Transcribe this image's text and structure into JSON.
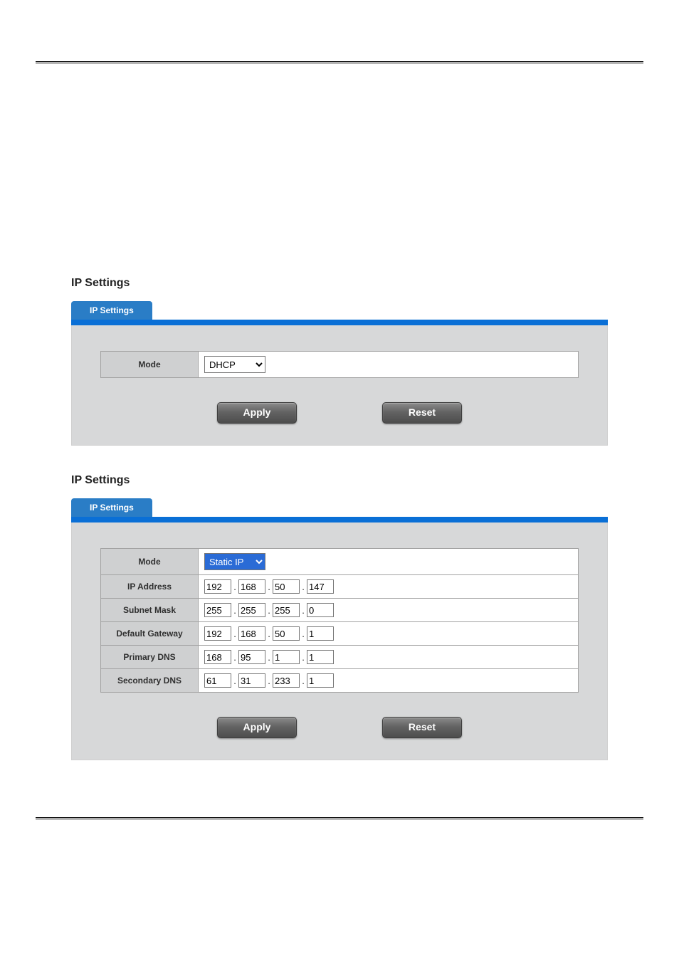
{
  "section1": {
    "title": "IP Settings",
    "tab_label": "IP Settings",
    "rows": {
      "mode": {
        "label": "Mode",
        "value": "DHCP",
        "options": [
          "DHCP",
          "Static IP"
        ]
      }
    },
    "buttons": {
      "apply": "Apply",
      "reset": "Reset"
    }
  },
  "section2": {
    "title": "IP Settings",
    "tab_label": "IP Settings",
    "rows": {
      "mode": {
        "label": "Mode",
        "value": "Static IP",
        "options": [
          "DHCP",
          "Static IP"
        ],
        "highlighted": true
      },
      "ip_address": {
        "label": "IP Address",
        "octets": [
          "192",
          "168",
          "50",
          "147"
        ]
      },
      "subnet_mask": {
        "label": "Subnet Mask",
        "octets": [
          "255",
          "255",
          "255",
          "0"
        ]
      },
      "default_gateway": {
        "label": "Default Gateway",
        "octets": [
          "192",
          "168",
          "50",
          "1"
        ]
      },
      "primary_dns": {
        "label": "Primary DNS",
        "octets": [
          "168",
          "95",
          "1",
          "1"
        ]
      },
      "secondary_dns": {
        "label": "Secondary DNS",
        "octets": [
          "61",
          "31",
          "233",
          "1"
        ]
      }
    },
    "buttons": {
      "apply": "Apply",
      "reset": "Reset"
    }
  }
}
